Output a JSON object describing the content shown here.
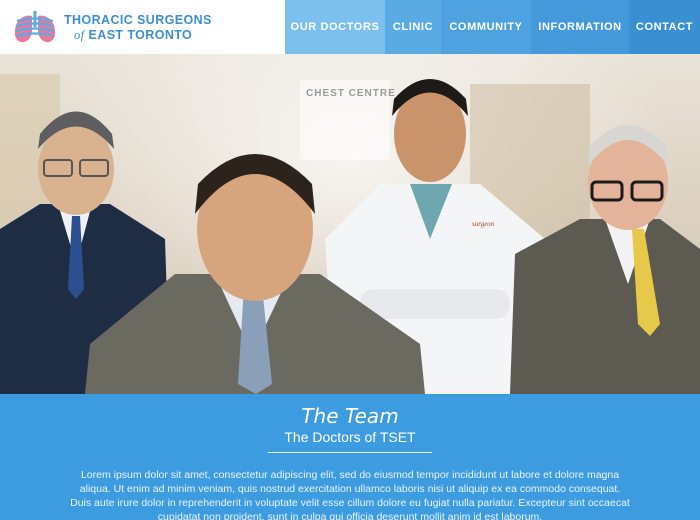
{
  "logo": {
    "line1": "THORACIC SURGEONS",
    "of": "of",
    "line2": "EAST TORONTO"
  },
  "nav": {
    "items": [
      "OUR DOCTORS",
      "CLINIC",
      "COMMUNITY",
      "INFORMATION",
      "CONTACT"
    ]
  },
  "hero": {
    "sign": "CHEST CENTRE"
  },
  "team": {
    "title": "The Team",
    "subtitle": "The Doctors of TSET",
    "body": "Lorem ipsum dolor sit amet, consectetur adipiscing elit, sed do eiusmod tempor incididunt ut labore et dolore magna aliqua. Ut enim ad minim veniam, quis nostrud exercitation ullamco laboris nisi ut aliquip ex ea commodo consequat. Duis aute irure dolor in reprehenderit in voluptate velit esse cillum dolore eu fugiat nulla pariatur. Excepteur sint occaecat cupidatat non proident, sunt in culpa qui officia deserunt mollit anim id est laborum."
  },
  "colors": {
    "brand": "#3a8fd0",
    "section": "#3d9be0"
  }
}
